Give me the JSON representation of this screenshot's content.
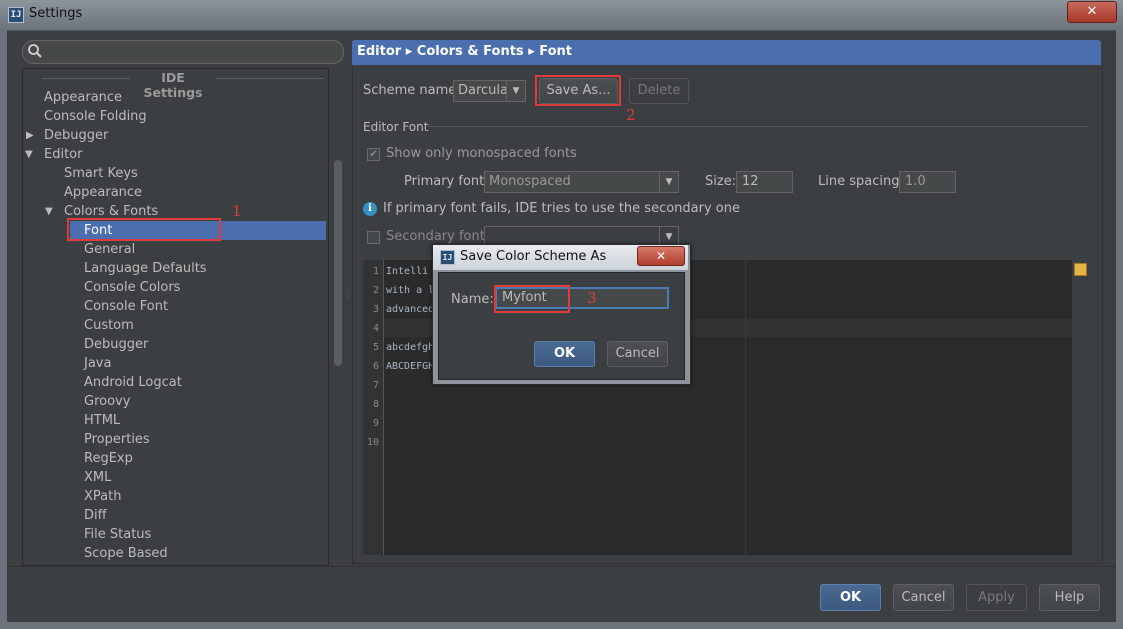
{
  "window": {
    "title": "Settings",
    "app_icon": "IJ",
    "close_glyph": "✕"
  },
  "search": {
    "placeholder": ""
  },
  "tree": {
    "header": "IDE Settings",
    "items": [
      {
        "label": "Appearance"
      },
      {
        "label": "Console Folding"
      },
      {
        "label": "Debugger",
        "expandable": true,
        "expanded": false
      },
      {
        "label": "Editor",
        "expandable": true,
        "expanded": true
      },
      {
        "label": "Smart Keys"
      },
      {
        "label": "Appearance"
      },
      {
        "label": "Colors & Fonts",
        "expandable": true,
        "expanded": true
      },
      {
        "label": "Font",
        "selected": true
      },
      {
        "label": "General"
      },
      {
        "label": "Language Defaults"
      },
      {
        "label": "Console Colors"
      },
      {
        "label": "Console Font"
      },
      {
        "label": "Custom"
      },
      {
        "label": "Debugger"
      },
      {
        "label": "Java"
      },
      {
        "label": "Android Logcat"
      },
      {
        "label": "Groovy"
      },
      {
        "label": "HTML"
      },
      {
        "label": "Properties"
      },
      {
        "label": "RegExp"
      },
      {
        "label": "XML"
      },
      {
        "label": "XPath"
      },
      {
        "label": "Diff"
      },
      {
        "label": "File Status"
      },
      {
        "label": "Scope Based"
      }
    ]
  },
  "breadcrumb": {
    "text": "Editor ▸ Colors & Fonts ▸ Font"
  },
  "scheme": {
    "label": "Scheme name:",
    "value": "Darcula",
    "save_as": "Save As...",
    "delete": "Delete"
  },
  "editor_font": {
    "section_label": "Editor Font",
    "monospaced_label": "Show only monospaced fonts",
    "monospaced_checked": true,
    "primary_label": "Primary font:",
    "primary_value": "Monospaced",
    "size_label": "Size:",
    "size_value": "12",
    "spacing_label": "Line spacing:",
    "spacing_value": "1.0",
    "info_text": "If primary font fails, IDE tries to use the secondary one",
    "secondary_label": "Secondary font:",
    "secondary_checked": false
  },
  "preview": {
    "line_numbers": [
      "1",
      "2",
      "3",
      "4",
      "5",
      "6",
      "7",
      "8",
      "9",
      "10"
    ],
    "lines": [
      "Intelli",
      "with a l",
      "advanced",
      "",
      "abcdefgh",
      "ABCDEFGH",
      "",
      "",
      "",
      ""
    ]
  },
  "annotations": {
    "n1": "1",
    "n2": "2",
    "n3": "3",
    "color": "#e03b3b"
  },
  "dialog": {
    "title": "Save Color Scheme As",
    "name_label": "Name:",
    "name_value": "Myfont",
    "ok": "OK",
    "cancel": "Cancel",
    "close_glyph": "✕"
  },
  "footer": {
    "ok": "OK",
    "cancel": "Cancel",
    "apply": "Apply",
    "help": "Help"
  },
  "colors": {
    "selection": "#4b6eaf",
    "background": "#3c3f41",
    "editor_bg": "#2b2b2b"
  }
}
